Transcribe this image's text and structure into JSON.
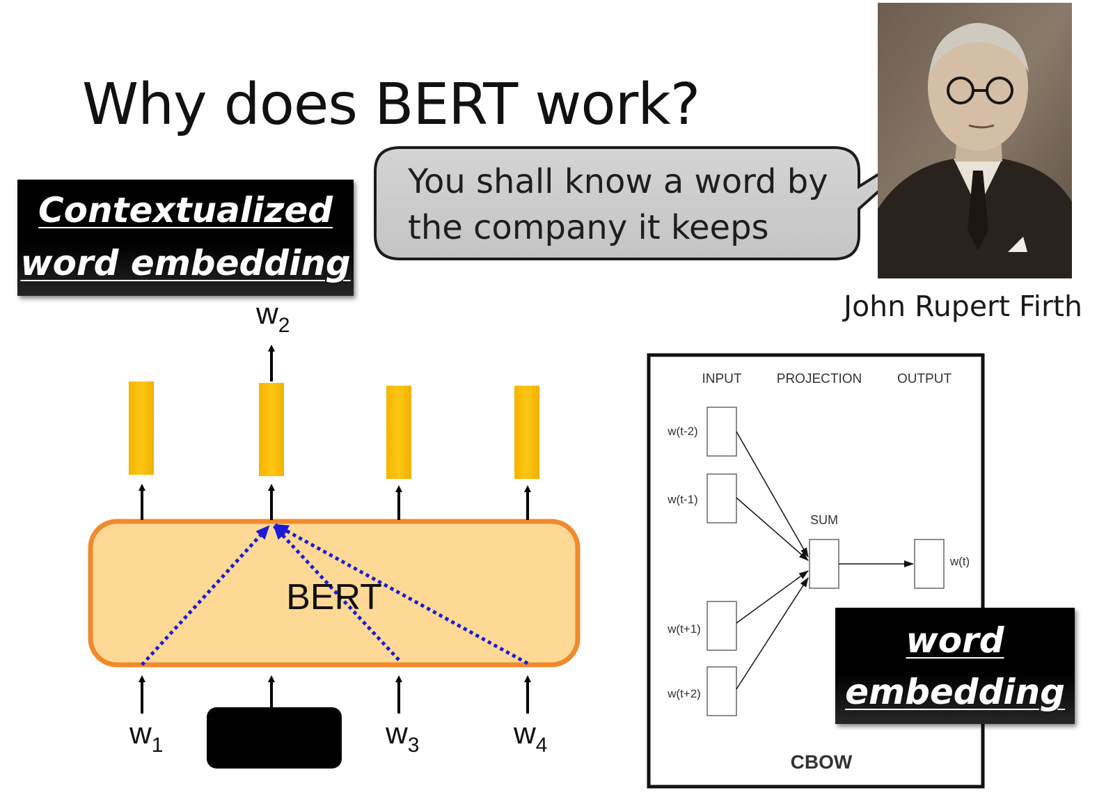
{
  "slide": {
    "title": "Why does BERT work?"
  },
  "labels": {
    "contextualized": [
      "Contextualized",
      "word embedding"
    ],
    "word_embedding": [
      "word",
      "embedding"
    ]
  },
  "quote": {
    "lines": [
      "You shall know a word by",
      "the company it keeps"
    ]
  },
  "portrait": {
    "caption": "John Rupert Firth"
  },
  "bert_diagram": {
    "model_label": "BERT",
    "output_label": {
      "base": "w",
      "sub": "2"
    },
    "inputs": [
      {
        "base": "w",
        "sub": "1"
      },
      {
        "base": "w",
        "sub": "3"
      },
      {
        "base": "w",
        "sub": "4"
      }
    ],
    "colors": {
      "bert_fill": "#fdd995",
      "bert_border": "#f08a2c",
      "embedding_bar": "#fbbe08",
      "attention": "#1a1ad8",
      "mask": "#000000"
    }
  },
  "cbow_diagram": {
    "headers": [
      "INPUT",
      "PROJECTION",
      "OUTPUT"
    ],
    "inputs": [
      "w(t-2)",
      "w(t-1)",
      "w(t+1)",
      "w(t+2)"
    ],
    "sum_label": "SUM",
    "output": "w(t)",
    "caption": "CBOW"
  }
}
